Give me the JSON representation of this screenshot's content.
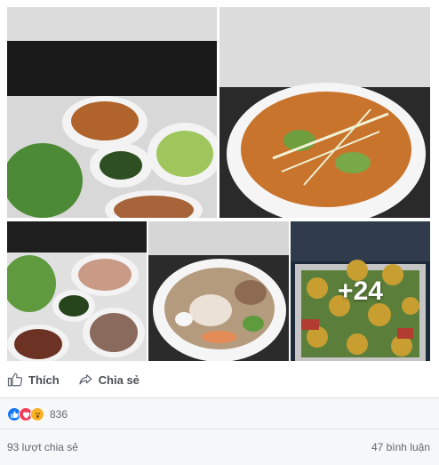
{
  "photos": {
    "more_count": "+24"
  },
  "actions": {
    "like_label": "Thích",
    "share_label": "Chia sẻ"
  },
  "reactions": {
    "count": "836",
    "colors": {
      "like": "#1877f2",
      "love": "#f33e58",
      "wow": "#f7b125"
    }
  },
  "stats": {
    "shares": "93 lượt chia sẻ",
    "comments": "47 bình luận"
  }
}
